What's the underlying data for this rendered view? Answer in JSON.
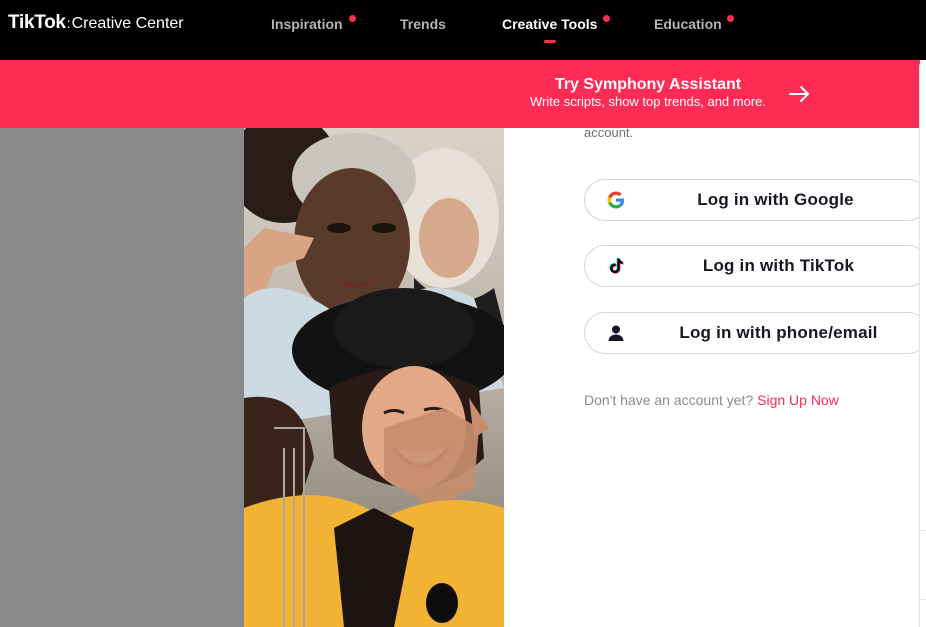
{
  "header": {
    "brand": "TikTok",
    "separator": ":",
    "product": "Creative Center",
    "nav": [
      {
        "label": "Inspiration",
        "has_dot": true,
        "active": false
      },
      {
        "label": "Trends",
        "has_dot": false,
        "active": false
      },
      {
        "label": "Creative Tools",
        "has_dot": true,
        "active": true
      },
      {
        "label": "Education",
        "has_dot": true,
        "active": false
      }
    ]
  },
  "banner": {
    "title": "Try Symphony Assistant",
    "subtitle": "Write scripts, show top trends, and more.",
    "icon": "arrow-right-icon"
  },
  "login": {
    "account_text": "account.",
    "buttons": [
      {
        "label": "Log in with Google",
        "icon": "google-icon"
      },
      {
        "label": "Log in with TikTok",
        "icon": "tiktok-icon"
      },
      {
        "label": "Log in with phone/email",
        "icon": "user-icon"
      }
    ],
    "signup_prompt": "Don't have an account yet?",
    "signup_link": "Sign Up Now"
  },
  "colors": {
    "accent": "#fe2c55",
    "header_bg": "#000000",
    "left_panel": "#8a8a8a"
  }
}
